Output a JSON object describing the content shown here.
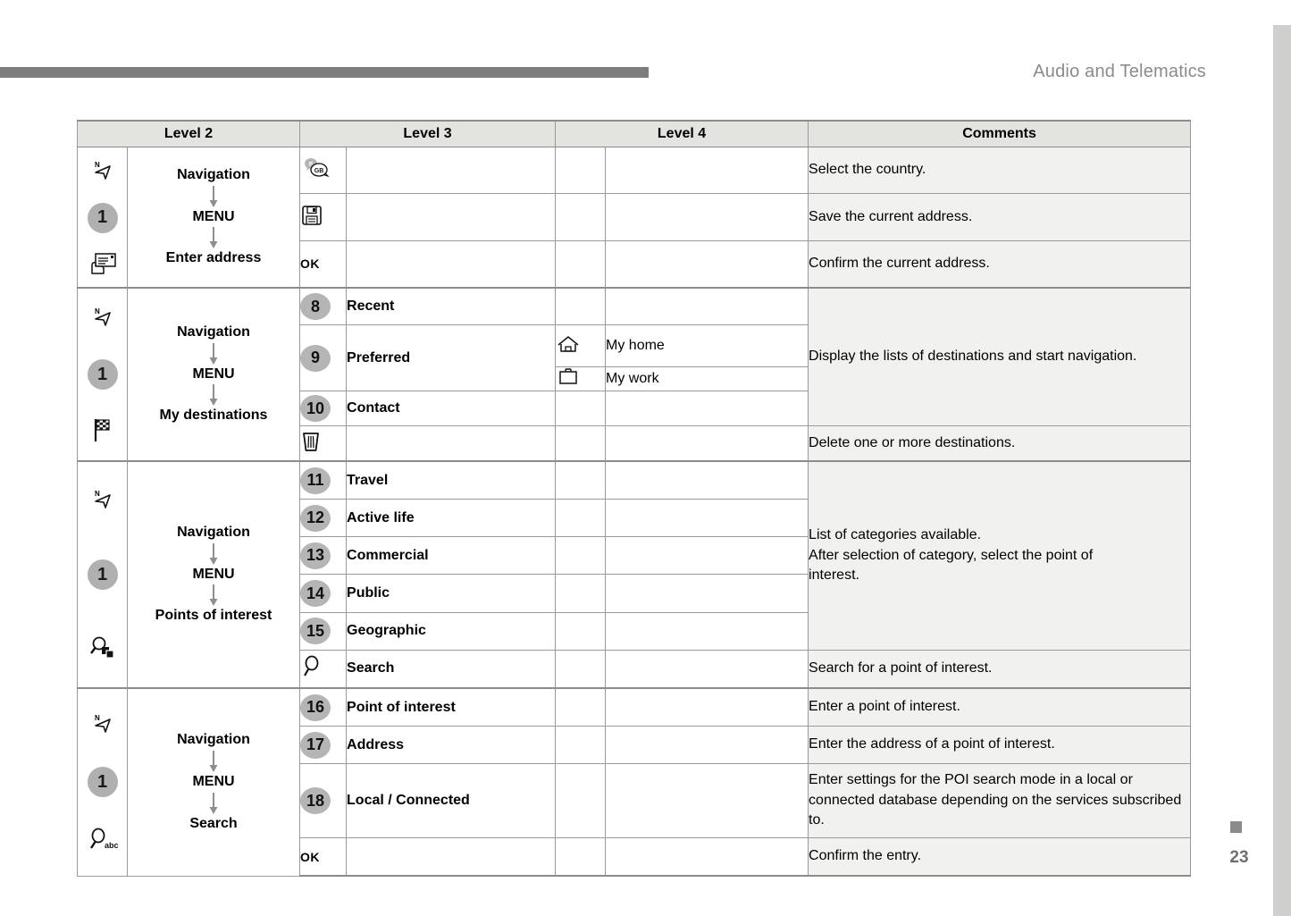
{
  "header": {
    "title": "Audio and Telematics",
    "rule_color": "#7d7d7d",
    "title_color": "#8b8b8b"
  },
  "footer": {
    "page_number": "23",
    "marker_color": "#8b8b8b"
  },
  "table": {
    "columns": [
      "Level 2",
      "Level 3",
      "Level 4",
      "Comments"
    ],
    "header_bg": "#e3e3e0",
    "comments_bg": "#f1f1ef",
    "badge_bg": "#b5b5b5",
    "groups": [
      {
        "id": "enter-address",
        "left_icons": [
          "compass-north-icon",
          "number-one-badge",
          "enter-address-icon"
        ],
        "path": {
          "l1": "Navigation",
          "l2": "MENU",
          "l3": "Enter address"
        },
        "rows": [
          {
            "l3_icon": "country-language-icon",
            "l3_badge": "",
            "l3_label": "",
            "l4_icon": "",
            "l4_label": "",
            "comment": "Select the country."
          },
          {
            "l3_icon": "floppy-save-icon",
            "l3_badge": "",
            "l3_label": "",
            "l4_icon": "",
            "l4_label": "",
            "comment": "Save the current address."
          },
          {
            "l3_icon": "ok-text",
            "l3_badge": "",
            "l3_label": "",
            "l4_icon": "",
            "l4_label": "",
            "comment": "Confirm the current address."
          }
        ]
      },
      {
        "id": "my-destinations",
        "left_icons": [
          "compass-north-icon",
          "number-one-badge",
          "checkered-flag-icon"
        ],
        "path": {
          "l1": "Navigation",
          "l2": "MENU",
          "l3": "My destinations"
        },
        "merged_comment": "Display the lists of destinations and start navigation.",
        "rows": [
          {
            "l3_badge": "8",
            "l3_label": "Recent",
            "l4_icon": "",
            "l4_label": ""
          },
          {
            "l3_badge": "9",
            "l3_label": "Preferred",
            "l4_icon": "home-icon",
            "l4_label": "My home"
          },
          {
            "l3_badge": "9",
            "l3_label": "Preferred",
            "l4_icon": "briefcase-icon",
            "l4_label": "My work"
          },
          {
            "l3_badge": "10",
            "l3_label": "Contact",
            "l4_icon": "",
            "l4_label": ""
          }
        ],
        "trailing_row": {
          "l3_icon": "trash-icon",
          "l3_label": "",
          "comment": "Delete one or more destinations."
        }
      },
      {
        "id": "points-of-interest",
        "left_icons": [
          "compass-north-icon",
          "number-one-badge",
          "poi-search-icon"
        ],
        "path": {
          "l1": "Navigation",
          "l2": "MENU",
          "l3": "Points of interest"
        },
        "merged_comment_line1": "List of categories available.",
        "merged_comment_line2": "After selection of category, select the point of",
        "merged_comment_line3": "interest.",
        "rows": [
          {
            "l3_badge": "11",
            "l3_label": "Travel"
          },
          {
            "l3_badge": "12",
            "l3_label": "Active life"
          },
          {
            "l3_badge": "13",
            "l3_label": "Commercial"
          },
          {
            "l3_badge": "14",
            "l3_label": "Public"
          },
          {
            "l3_badge": "15",
            "l3_label": "Geographic"
          }
        ],
        "trailing_row": {
          "l3_icon": "magnifier-icon",
          "l3_label": "Search",
          "comment": "Search for a point of interest."
        }
      },
      {
        "id": "search",
        "left_icons": [
          "compass-north-icon",
          "number-one-badge",
          "magnifier-abc-icon"
        ],
        "path": {
          "l1": "Navigation",
          "l2": "MENU",
          "l3": "Search"
        },
        "rows": [
          {
            "l3_badge": "16",
            "l3_label": "Point of interest",
            "comment": "Enter a point of interest."
          },
          {
            "l3_badge": "17",
            "l3_label": "Address",
            "comment": "Enter the address of a point of interest."
          },
          {
            "l3_badge": "18",
            "l3_label": "Local / Connected",
            "comment": "Enter settings for the POI search mode in a local or connected database depending on the services subscribed to."
          }
        ],
        "trailing_row": {
          "l3_icon": "ok-text",
          "l3_label": "",
          "comment": "Confirm the entry."
        }
      }
    ],
    "ok_label": "OK",
    "abc_label": "abc",
    "lang_f": "F",
    "lang_gb": "GB"
  }
}
